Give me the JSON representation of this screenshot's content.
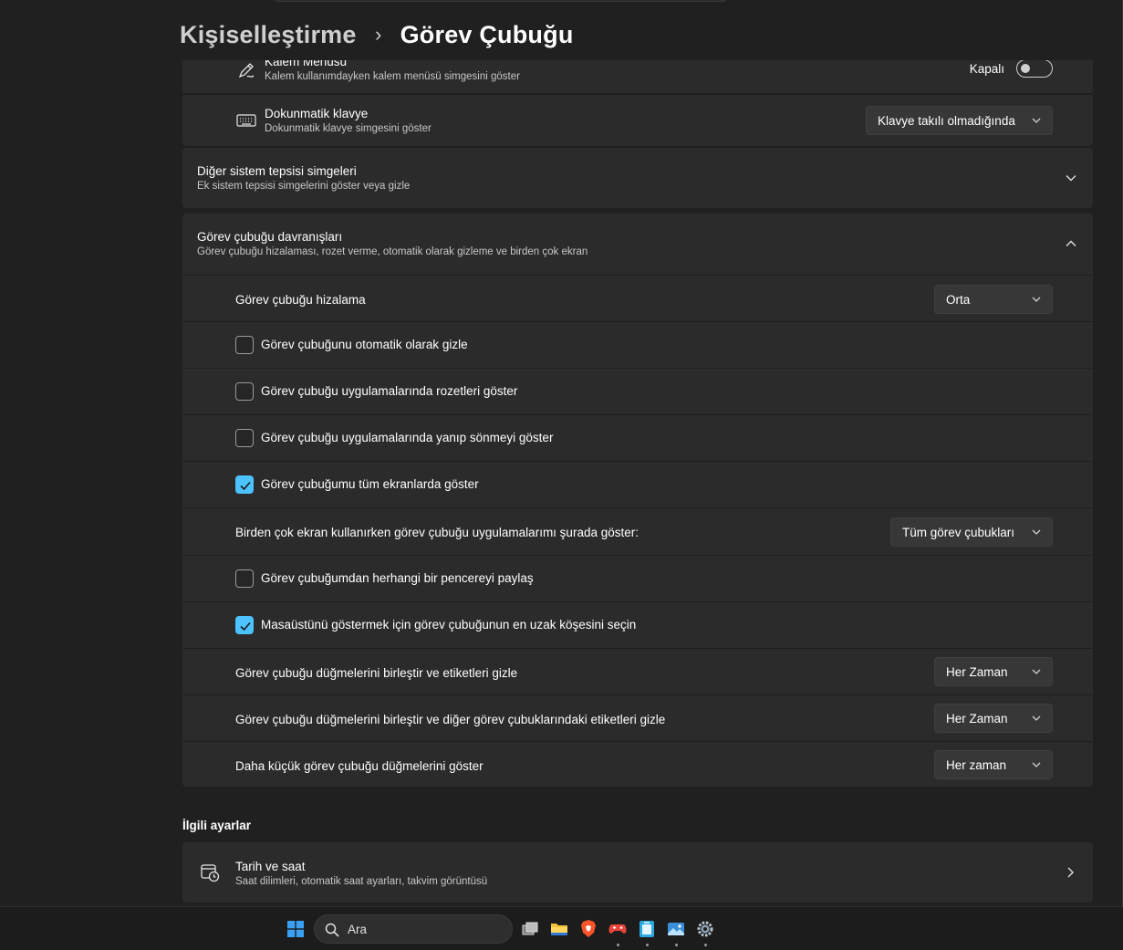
{
  "breadcrumb": {
    "parent": "Kişiselleştirme",
    "separator": "›",
    "current": "Görev Çubuğu"
  },
  "pen_menu": {
    "title": "Kalem Menüsü",
    "desc": "Kalem kullanımdayken kalem menüsü simgesini göster",
    "toggle_label": "Kapalı",
    "toggle_on": false,
    "icon": "pen-icon"
  },
  "touch_keyboard": {
    "title": "Dokunmatik klavye",
    "desc": "Dokunmatik klavye simgesini göster",
    "dropdown": "Klavye takılı olmadığında",
    "icon": "keyboard-icon"
  },
  "other_tray": {
    "title": "Diğer sistem tepsisi simgeleri",
    "desc": "Ek sistem tepsisi simgelerini göster veya gizle",
    "expanded": false
  },
  "behaviors": {
    "title": "Görev çubuğu davranışları",
    "desc": "Görev çubuğu hizalaması, rozet verme, otomatik olarak gizleme ve birden çok ekran",
    "expanded": true,
    "alignment": {
      "label": "Görev çubuğu hizalama",
      "value": "Orta"
    },
    "autohide": {
      "label": "Görev çubuğunu otomatik olarak gizle",
      "checked": false
    },
    "badges": {
      "label": "Görev çubuğu uygulamalarında rozetleri göster",
      "checked": false
    },
    "flashing": {
      "label": "Görev çubuğu uygulamalarında yanıp sönmeyi göster",
      "checked": false
    },
    "all_displays": {
      "label": "Görev çubuğumu tüm ekranlarda göster",
      "checked": true
    },
    "multi_display_apps": {
      "label": "Birden çok ekran kullanırken görev çubuğu uygulamalarımı şurada göster:",
      "value": "Tüm görev çubukları"
    },
    "share_window": {
      "label": "Görev çubuğumdan herhangi bir pencereyi paylaş",
      "checked": false
    },
    "far_corner": {
      "label": "Masaüstünü göstermek için görev çubuğunun en uzak köşesini seçin",
      "checked": true
    },
    "combine_buttons": {
      "label": "Görev çubuğu düğmelerini birleştir ve etiketleri gizle",
      "value": "Her Zaman"
    },
    "combine_other": {
      "label": "Görev çubuğu düğmelerini birleştir ve diğer görev çubuklarındaki etiketleri gizle",
      "value": "Her Zaman"
    },
    "smaller_buttons": {
      "label": "Daha küçük görev çubuğu düğmelerini göster",
      "value": "Her zaman"
    }
  },
  "related": {
    "heading": "İlgili ayarlar",
    "date_time": {
      "title": "Tarih ve saat",
      "desc": "Saat dilimleri, otomatik saat ayarları, takvim görüntüsü",
      "icon": "calendar-clock-icon"
    }
  },
  "taskbar": {
    "search_placeholder": "Ara",
    "icons": [
      "windows-start-icon",
      "task-view-icon",
      "file-explorer-icon",
      "brave-browser-icon",
      "game-controller-icon",
      "recycle-app-icon",
      "photos-icon",
      "settings-gear-icon"
    ]
  },
  "colors": {
    "accent": "#4cc2ff",
    "card": "#2b2b2b",
    "background": "#202020"
  }
}
